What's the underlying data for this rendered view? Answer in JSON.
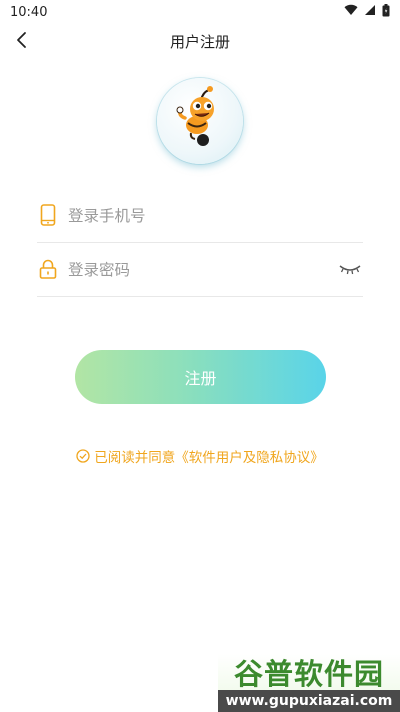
{
  "status": {
    "time": "10:40"
  },
  "header": {
    "title": "用户注册"
  },
  "fields": {
    "phone": {
      "placeholder": "登录手机号"
    },
    "password": {
      "placeholder": "登录密码"
    }
  },
  "register": {
    "label": "注册"
  },
  "agreement": {
    "prefix": "已阅读并同意",
    "link": "《软件用户及隐私协议》"
  },
  "watermark": {
    "title": "谷普软件园",
    "url": "www.gupuxiazai.com"
  },
  "colors": {
    "accent": "#f0a61e",
    "button_from": "#a9e29a",
    "button_to": "#47cfe6"
  },
  "icons": [
    "wifi-icon",
    "cellular-icon",
    "battery-icon",
    "back-arrow-icon",
    "mascot-logo",
    "phone-icon",
    "lock-icon",
    "eye-closed-icon",
    "check-circle-icon"
  ]
}
